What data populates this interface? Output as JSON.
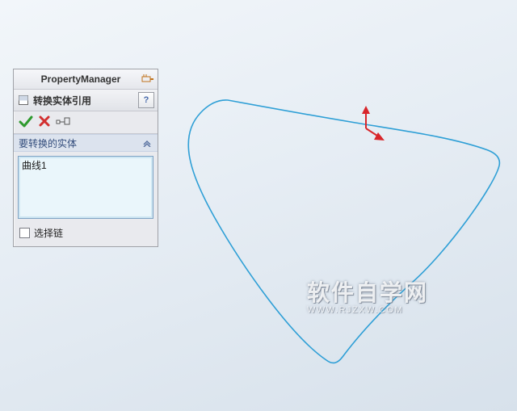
{
  "panel": {
    "title": "PropertyManager",
    "feature_label": "转换实体引用",
    "help_symbol": "?",
    "group_title": "要转换的实体",
    "selected_items": [
      "曲线1"
    ],
    "checkbox_label": "选择链",
    "checkbox_checked": false
  },
  "watermark": {
    "line1": "软件自学网",
    "line2": "WWW.RJZXW.COM"
  },
  "colors": {
    "curve": "#2e9fd6",
    "axis_arrow": "#d8252a",
    "panel_bg": "#e9eaee",
    "group_header": "#dce3ee"
  }
}
